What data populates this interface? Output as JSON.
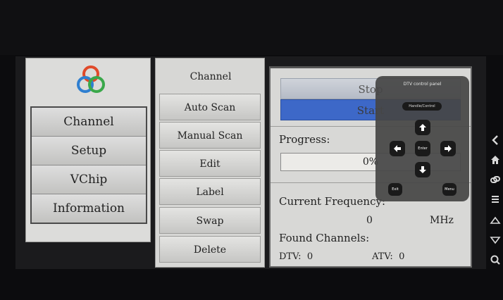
{
  "sidebar": {
    "logo_icon": "tri-ring-logo-icon",
    "items": [
      {
        "label": "Channel"
      },
      {
        "label": "Setup"
      },
      {
        "label": "VChip"
      },
      {
        "label": "Information"
      }
    ]
  },
  "channel_menu": {
    "title": "Channel",
    "buttons": [
      {
        "label": "Auto Scan"
      },
      {
        "label": "Manual Scan"
      },
      {
        "label": "Edit"
      },
      {
        "label": "Label"
      },
      {
        "label": "Swap"
      },
      {
        "label": "Delete"
      }
    ]
  },
  "scan": {
    "stop_label": "Stop",
    "start_label": "Start",
    "progress_label": "Progress:",
    "progress_value": 0,
    "progress_text": "0%",
    "current_frequency_label": "Current Frequency:",
    "frequency_value": "0",
    "frequency_unit": "MHz",
    "found_channels_label": "Found Channels:",
    "dtv_label": "DTV:",
    "dtv_count": "0",
    "atv_label": "ATV:",
    "atv_count": "0",
    "accent_color": "#3d68c8"
  },
  "control_panel": {
    "title": "DTV control panel",
    "mode_label": "Handle/Control",
    "enter_label": "Enter",
    "exit_label": "Exit",
    "menu_label": "Menu",
    "icons": [
      "arrow-up-icon",
      "arrow-left-icon",
      "arrow-right-icon",
      "arrow-down-icon"
    ]
  },
  "nav_bar": {
    "icons": [
      "back-icon",
      "home-icon",
      "link-icon",
      "menu-icon",
      "triangle-up-icon",
      "triangle-down-icon",
      "search-icon"
    ]
  }
}
